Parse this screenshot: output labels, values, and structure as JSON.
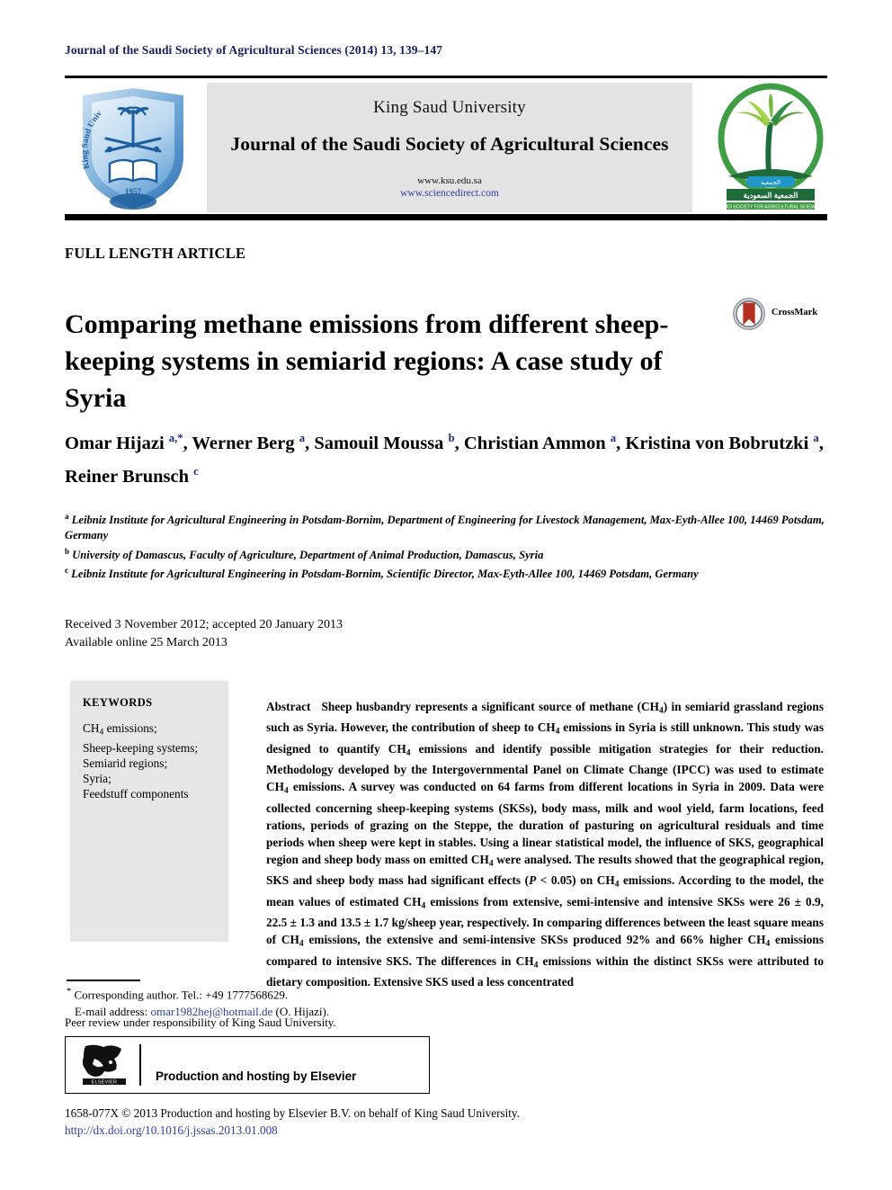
{
  "running_head": "Journal of the Saudi Society of Agricultural Sciences (2014) 13, 139–147",
  "masthead": {
    "university": "King Saud University",
    "journal_title": "Journal of the Saudi Society of Agricultural Sciences",
    "url_ksu": "www.ksu.edu.sa",
    "url_sciencedirect": "www.sciencedirect.com",
    "ksu_logo_alt": "King Saud University",
    "ksu_logo_year": "1957",
    "ssas_logo_alt": "Saudi Society for Agricultural Sciences"
  },
  "article_type": "FULL LENGTH ARTICLE",
  "title": "Comparing methane emissions from different sheep-keeping systems in semiarid regions: A case study of Syria",
  "crossmark": {
    "label": "CrossMark"
  },
  "authors": [
    {
      "name": "Omar Hijazi",
      "sup": "a,*",
      "sep": ", "
    },
    {
      "name": "Werner Berg",
      "sup": "a",
      "sep": ", "
    },
    {
      "name": "Samouil Moussa",
      "sup": "b",
      "sep": ", "
    },
    {
      "name": "Christian Ammon",
      "sup": "a",
      "sep": ", "
    },
    {
      "name": "Kristina von Bobrutzki",
      "sup": "a",
      "sep": ", "
    },
    {
      "name": "Reiner Brunsch",
      "sup": "c",
      "sep": ""
    }
  ],
  "affiliations": [
    {
      "marker": "a",
      "text": "Leibniz Institute for Agricultural Engineering in Potsdam-Bornim, Department of Engineering for Livestock Management, Max-Eyth-Allee 100, 14469 Potsdam, Germany"
    },
    {
      "marker": "b",
      "text": "University of Damascus, Faculty of Agriculture, Department of Animal Production, Damascus, Syria"
    },
    {
      "marker": "c",
      "text": "Leibniz Institute for Agricultural Engineering in Potsdam-Bornim, Scientific Director, Max-Eyth-Allee 100, 14469 Potsdam, Germany"
    }
  ],
  "dates": {
    "received": "Received 3 November 2012; accepted 20 January 2013",
    "available": "Available online 25 March 2013"
  },
  "keywords": {
    "heading": "KEYWORDS",
    "items": [
      "CH4 emissions;",
      "Sheep-keeping systems;",
      "Semiarid regions;",
      "Syria;",
      "Feedstuff components"
    ]
  },
  "abstract": {
    "label": "Abstract",
    "text": "Sheep husbandry represents a significant source of methane (CH4) in semiarid grassland regions such as Syria. However, the contribution of sheep to CH4 emissions in Syria is still unknown. This study was designed to quantify CH4 emissions and identify possible mitigation strategies for their reduction. Methodology developed by the Intergovernmental Panel on Climate Change (IPCC) was used to estimate CH4 emissions. A survey was conducted on 64 farms from different locations in Syria in 2009. Data were collected concerning sheep-keeping systems (SKSs), body mass, milk and wool yield, farm locations, feed rations, periods of grazing on the Steppe, the duration of pasturing on agricultural residuals and time periods when sheep were kept in stables. Using a linear statistical model, the influence of SKS, geographical region and sheep body mass on emitted CH4 were analysed. The results showed that the geographical region, SKS and sheep body mass had significant effects (P < 0.05) on CH4 emissions. According to the model, the mean values of estimated CH4 emissions from extensive, semi-intensive and intensive SKSs were 26 ± 0.9, 22.5 ± 1.3 and 13.5 ± 1.7 kg/sheep year, respectively. In comparing differences between the least square means of CH4 emissions, the extensive and semi-intensive SKSs produced 92% and 66% higher CH4 emissions compared to intensive SKS. The differences in CH4 emissions within the distinct SKSs were attributed to dietary composition. Extensive SKS used a less concentrated"
  },
  "footnotes": {
    "corresponding": "Corresponding author. Tel.: +49 1777568629.",
    "email_label": "E-mail address:",
    "email": "omar1982hej@hotmail.de",
    "email_suffix": "(O. Hijazi).",
    "peer_review": "Peer review under responsibility of King Saud University."
  },
  "elsevier_box": {
    "text": "Production and hosting by Elsevier",
    "logo_label": "ELSEVIER"
  },
  "copyright": {
    "line1": "1658-077X © 2013 Production and hosting by Elsevier B.V. on behalf of King Saud University.",
    "doi": "http://dx.doi.org/10.1016/j.jssas.2013.01.008"
  },
  "colors": {
    "navy": "#14205c",
    "link_blue": "#2b3fa0",
    "banner_gray": "#e3e3e3",
    "keywords_gray": "#e6e6e6",
    "ksu_blue": "#2c6fb5",
    "ssas_green": "#3f9e43"
  }
}
